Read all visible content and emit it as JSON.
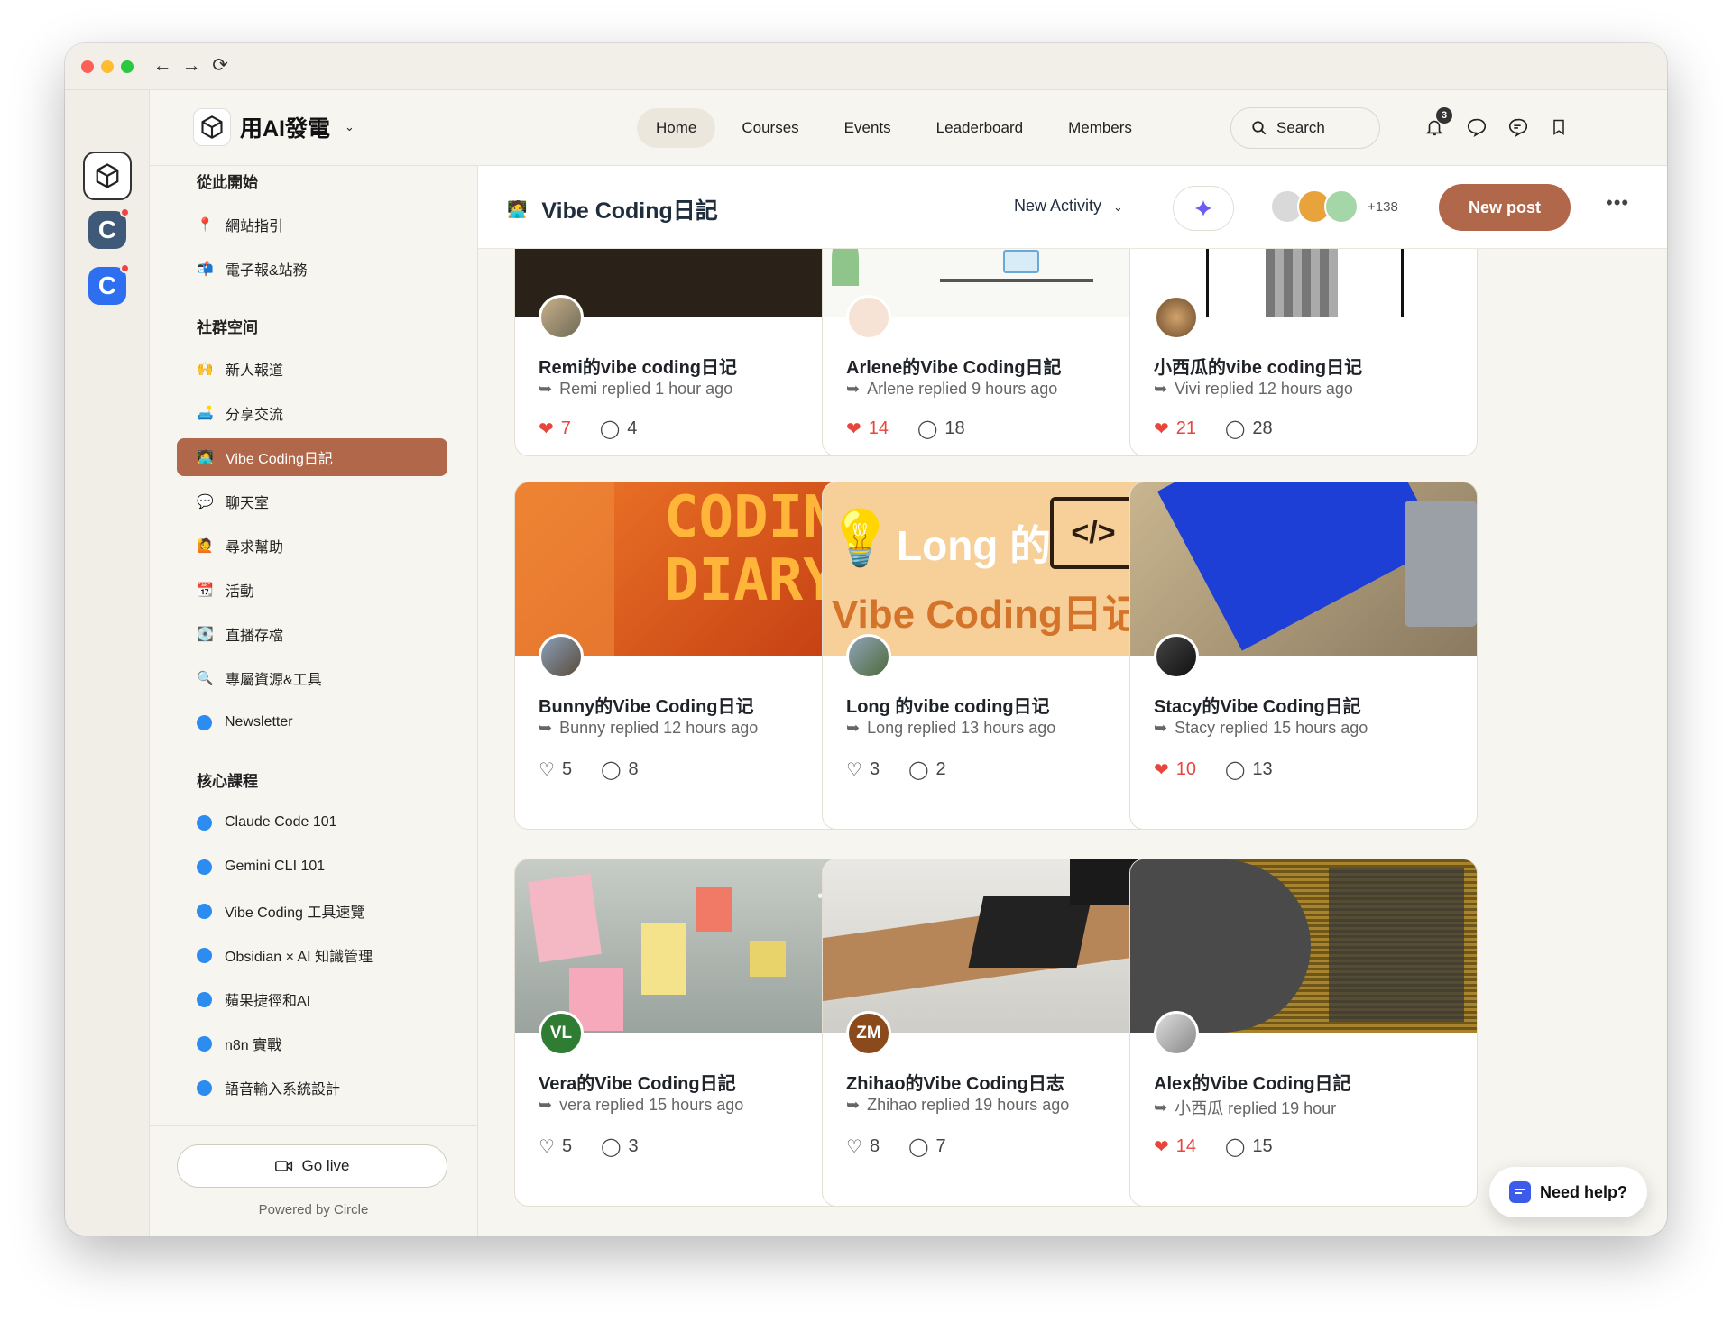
{
  "app": {
    "brand_name": "用AI發電",
    "powered_by": "Powered by Circle"
  },
  "nav": {
    "items": [
      "Home",
      "Courses",
      "Events",
      "Leaderboard",
      "Members"
    ],
    "active": "Home"
  },
  "search": {
    "label": "Search"
  },
  "notifications": {
    "count": "3"
  },
  "sidebar": {
    "sections": [
      {
        "title": "從此開始",
        "items": [
          {
            "icon": "📍",
            "label": "網站指引"
          },
          {
            "icon": "📬",
            "label": "電子報&站務"
          }
        ]
      },
      {
        "title": "社群空间",
        "items": [
          {
            "icon": "🙌",
            "label": "新人報道"
          },
          {
            "icon": "🛋️",
            "label": "分享交流"
          },
          {
            "icon": "🧑‍💻",
            "label": "Vibe Coding日記"
          },
          {
            "icon": "💬",
            "label": "聊天室"
          },
          {
            "icon": "🙋",
            "label": "尋求幫助"
          },
          {
            "icon": "📆",
            "label": "活動"
          },
          {
            "icon": "💽",
            "label": "直播存檔"
          },
          {
            "icon": "🔍",
            "label": "專屬資源&工具"
          },
          {
            "icon": "dot",
            "label": "Newsletter"
          }
        ]
      },
      {
        "title": "核心課程",
        "items": [
          {
            "icon": "dot",
            "label": "Claude Code 101"
          },
          {
            "icon": "dot",
            "label": "Gemini CLI 101"
          },
          {
            "icon": "dot",
            "label": "Vibe Coding 工具速覽"
          },
          {
            "icon": "dot",
            "label": "Obsidian × AI 知識管理"
          },
          {
            "icon": "dot",
            "label": "蘋果捷徑和AI"
          },
          {
            "icon": "dot",
            "label": "n8n 實戰"
          },
          {
            "icon": "dot",
            "label": "語音輸入系統設計"
          }
        ]
      }
    ],
    "active_item": "Vibe Coding日記",
    "go_live": "Go live"
  },
  "space": {
    "icon": "🧑‍💻",
    "title": "Vibe Coding日記",
    "sort_label": "New Activity",
    "member_count": "+138",
    "new_post": "New post"
  },
  "posts": [
    {
      "title": "Remi的vibe coding日记",
      "reply": "Remi replied 1 hour ago",
      "likes": "7",
      "comments": "4",
      "liked": true
    },
    {
      "title": "Arlene的Vibe Coding日記",
      "reply": "Arlene replied 9 hours ago",
      "likes": "14",
      "comments": "18",
      "liked": true
    },
    {
      "title": "小西瓜的vibe coding日记",
      "reply": "Vivi replied 12 hours ago",
      "likes": "21",
      "comments": "28",
      "liked": true
    },
    {
      "title": "Bunny的Vibe Coding日记",
      "reply": "Bunny replied 12 hours ago",
      "likes": "5",
      "comments": "8",
      "liked": false,
      "cover_text": [
        "CODIN",
        "DIARY"
      ]
    },
    {
      "title": "Long 的vibe coding日记",
      "reply": "Long replied 13 hours ago",
      "likes": "3",
      "comments": "2",
      "liked": false,
      "cover_text": [
        "Long 的",
        "Vibe Coding日记"
      ]
    },
    {
      "title": "Stacy的Vibe Coding日記",
      "reply": "Stacy replied 15 hours ago",
      "likes": "10",
      "comments": "13",
      "liked": true
    },
    {
      "title": "Vera的Vibe Coding日記",
      "reply": "vera replied 15 hours ago",
      "likes": "5",
      "comments": "3",
      "liked": false,
      "initials": "VL"
    },
    {
      "title": "Zhihao的Vibe Coding日志",
      "reply": "Zhihao replied 19 hours ago",
      "likes": "8",
      "comments": "7",
      "liked": false,
      "initials": "ZM"
    },
    {
      "title": "Alex的Vibe Coding日記",
      "reply": "小西瓜 replied 19 hour",
      "likes": "14",
      "comments": "15",
      "liked": true
    }
  ],
  "help": {
    "label": "Need help?"
  },
  "colors": {
    "accent": "#b0674a",
    "like": "#e8453c",
    "link_dot": "#2d8cf0"
  }
}
